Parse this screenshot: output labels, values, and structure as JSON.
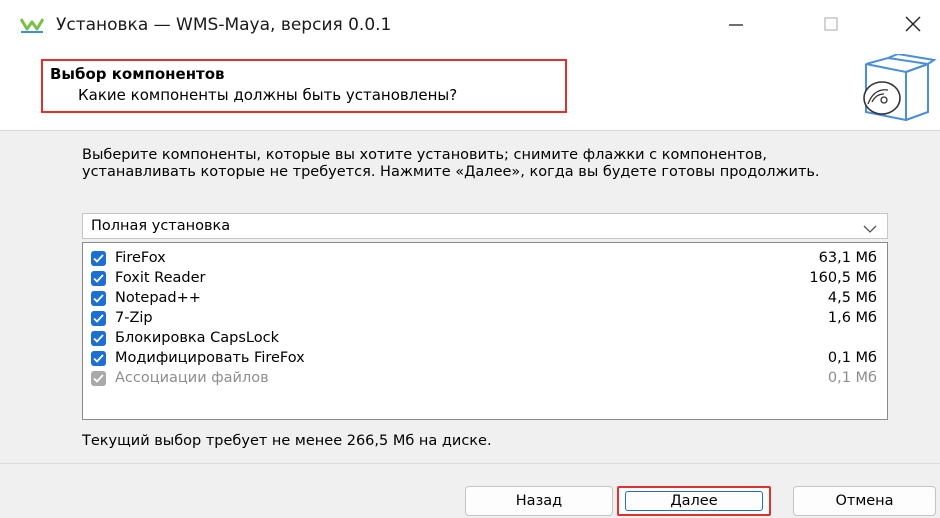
{
  "window": {
    "title": "Установка — WMS-Maya, версия 0.0.1",
    "icon": "wms-maya-logo-icon",
    "controls": [
      "minimize-icon",
      "maximize-icon",
      "close-icon"
    ]
  },
  "header": {
    "title": "Выбор компонентов",
    "subtitle": "Какие компоненты должны быть установлены?",
    "icon": "install-box-disc-icon",
    "highlight_color": "#e03030"
  },
  "main": {
    "intro": "Выберите компоненты, которые вы хотите установить; снимите флажки с компонентов, устанавливать которые не требуется. Нажмите «Далее», когда вы будете готовы продолжить.",
    "install_type": {
      "selected": "Полная установка"
    },
    "components": [
      {
        "label": "FireFox",
        "size": "63,1 Мб",
        "checked": true,
        "enabled": true
      },
      {
        "label": "Foxit Reader",
        "size": "160,5 Мб",
        "checked": true,
        "enabled": true
      },
      {
        "label": "Notepad++",
        "size": "4,5 Мб",
        "checked": true,
        "enabled": true
      },
      {
        "label": "7-Zip",
        "size": "1,6 Мб",
        "checked": true,
        "enabled": true
      },
      {
        "label": "Блокировка CapsLock",
        "size": "",
        "checked": true,
        "enabled": true
      },
      {
        "label": "Модифицировать FireFox",
        "size": "0,1 Мб",
        "checked": true,
        "enabled": true
      },
      {
        "label": "Ассоциации файлов",
        "size": "0,1 Мб",
        "checked": true,
        "enabled": false
      }
    ],
    "status": "Текущий выбор требует не менее 266,5 Мб на диске."
  },
  "footer": {
    "back_label": "Назад",
    "next_label": "Далее",
    "cancel_label": "Отмена"
  },
  "colors": {
    "accent": "#1d6fd1",
    "disabled": "#a9a9a9"
  }
}
